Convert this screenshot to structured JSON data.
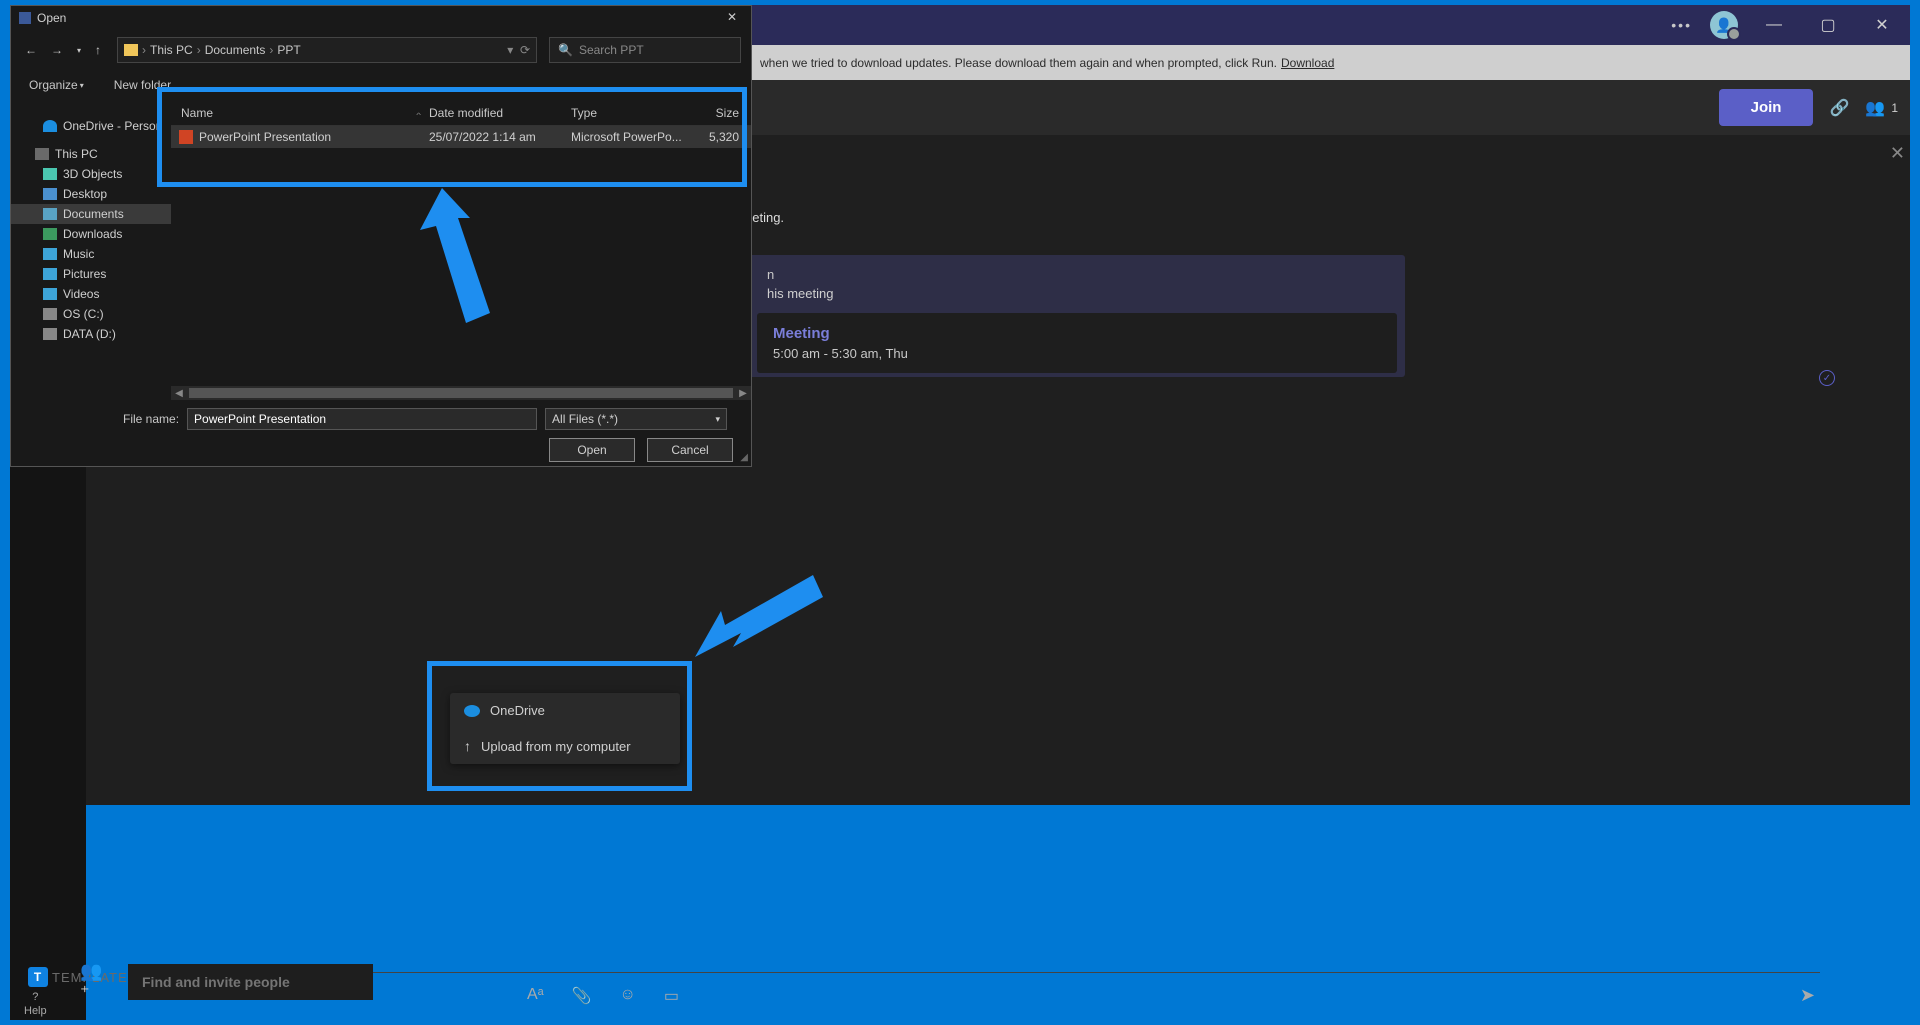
{
  "dialog": {
    "title": "Open",
    "breadcrumb": [
      "This PC",
      "Documents",
      "PPT"
    ],
    "search_placeholder": "Search PPT",
    "toolbar": {
      "organize": "Organize",
      "new_folder": "New folder"
    },
    "sidebar": [
      {
        "label": "OneDrive - Person",
        "icon": "cloud"
      },
      {
        "label": "This PC",
        "icon": "pc"
      },
      {
        "label": "3D Objects",
        "icon": "3d"
      },
      {
        "label": "Desktop",
        "icon": "desk"
      },
      {
        "label": "Documents",
        "icon": "doc",
        "active": true
      },
      {
        "label": "Downloads",
        "icon": "down"
      },
      {
        "label": "Music",
        "icon": "music"
      },
      {
        "label": "Pictures",
        "icon": "pic"
      },
      {
        "label": "Videos",
        "icon": "video"
      },
      {
        "label": "OS (C:)",
        "icon": "drive"
      },
      {
        "label": "DATA (D:)",
        "icon": "drive"
      }
    ],
    "columns": {
      "name": "Name",
      "date": "Date modified",
      "type": "Type",
      "size": "Size"
    },
    "files": [
      {
        "name": "PowerPoint Presentation",
        "date": "25/07/2022 1:14 am",
        "type": "Microsoft PowerPo...",
        "size": "5,320"
      }
    ],
    "filename_label": "File name:",
    "filename_value": "PowerPoint Presentation",
    "filetype_value": "All Files (*.*)",
    "open_btn": "Open",
    "cancel_btn": "Cancel"
  },
  "teams": {
    "notification_text": "when we tried to download updates. Please download them again and when prompted, click Run.",
    "download_link": "Download",
    "join_btn": "Join",
    "people_count": "1",
    "meeting_text_hint": "eeting.",
    "meeting_card_header": "his meeting",
    "meeting_card_sub": "n",
    "meeting_title": "Meeting",
    "meeting_time": "5:00 am - 5:30 am, Thu"
  },
  "upload_menu": {
    "onedrive": "OneDrive",
    "upload": "Upload from my computer"
  },
  "bottom": {
    "invite_placeholder": "Find and invite people",
    "help": "Help"
  },
  "logo": "TEMPLATETIER"
}
